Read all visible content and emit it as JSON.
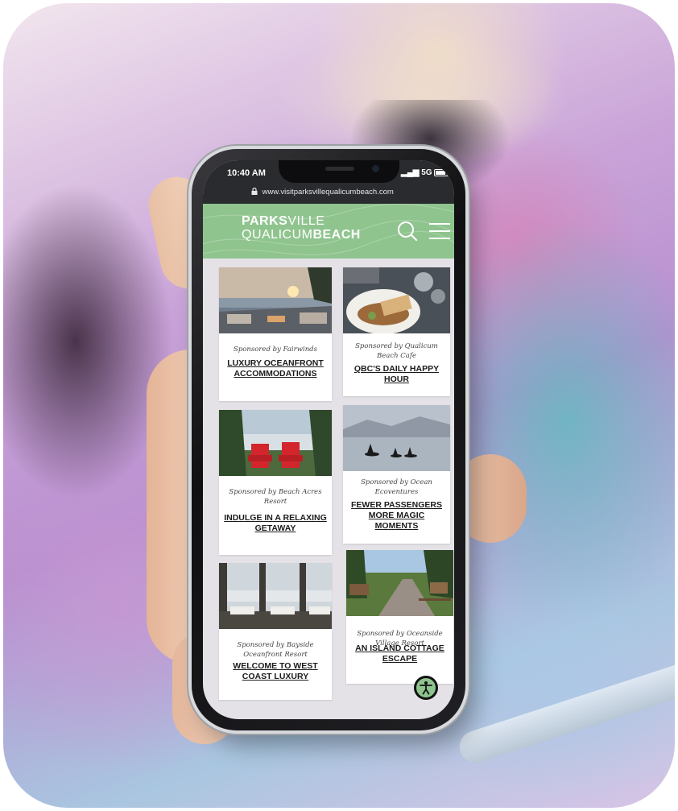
{
  "status_bar": {
    "time": "10:40 AM",
    "network": "5G",
    "url": "www.visitparksvillequalicumbeach.com"
  },
  "logo": {
    "line1_bold": "PARKS",
    "line1_light": "VILLE",
    "line2_light": "QUALICUM",
    "line2_bold": "BEACH"
  },
  "cards": [
    {
      "sponsor": "Sponsored by Fairwinds",
      "title": "LUXURY OCEANFRONT ACCOMMODATIONS"
    },
    {
      "sponsor": "Sponsored by Qualicum Beach Cafe",
      "title": "QBC'S DAILY HAPPY HOUR"
    },
    {
      "sponsor": "Sponsored by Beach Acres Resort",
      "title": "INDULGE IN A RELAXING GETAWAY"
    },
    {
      "sponsor": "Sponsored by Ocean Ecoventures",
      "title": "FEWER PASSENGERS MORE MAGIC MOMENTS"
    },
    {
      "sponsor": "Sponsored by Bayside Oceanfront Resort",
      "title": "WELCOME TO WEST COAST LUXURY"
    },
    {
      "sponsor": "Sponsored by Oceanside Village Resort",
      "title": "AN ISLAND COTTAGE ESCAPE"
    }
  ],
  "colors": {
    "header_green": "#8fc48e",
    "status_bar": "#2a2b2e",
    "page_bg": "#e4e2e6"
  },
  "icons": {
    "search": "search-icon",
    "menu": "hamburger-menu-icon",
    "accessibility": "accessibility-icon",
    "lock": "lock-icon"
  }
}
